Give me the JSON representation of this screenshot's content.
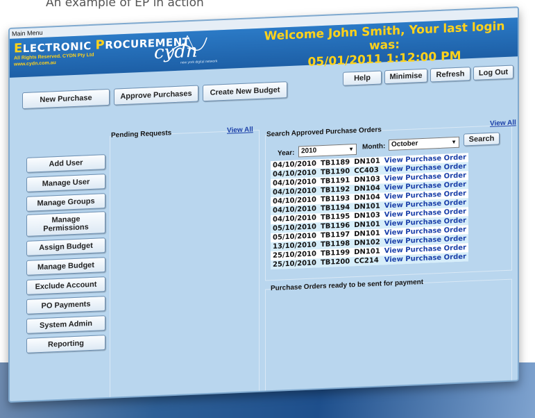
{
  "caption": "An example of EP in action",
  "window": {
    "title": "Main Menu"
  },
  "header": {
    "logo_first_letter": "E",
    "logo_word1_rest": "LECTRONIC ",
    "logo_word2_first": "P",
    "logo_word2_rest": "ROCUREMENT",
    "logo_sub_line1": "All Rights Reserved. CYDN Pty Ltd",
    "logo_sub_line2": "www.cydn.com.au",
    "brand": "cydn",
    "brand_tagline": "new york digital network",
    "welcome_line1": "Welcome John Smith, Your last login was:",
    "welcome_line2": "05/01/2011 1:12:00 PM"
  },
  "top_buttons": {
    "help": "Help",
    "minimise": "Minimise",
    "refresh": "Refresh",
    "logout": "Log Out"
  },
  "tabs": {
    "new_purchase": "New Purchase",
    "approve_purchases": "Approve Purchases",
    "create_budget": "Create New Budget"
  },
  "sidebar": [
    "Add User",
    "Manage User",
    "Manage Groups",
    "Manage\nPermissions",
    "Assign Budget",
    "Manage Budget",
    "Exclude Account",
    "PO Payments",
    "System Admin",
    "Reporting"
  ],
  "pending": {
    "title": "Pending Requests",
    "view_all": "View All"
  },
  "search": {
    "title": "Search Approved Purchase Orders",
    "view_all": "View All",
    "year_label": "Year:",
    "year_value": "2010",
    "month_label": "Month:",
    "month_value": "October",
    "button": "Search"
  },
  "orders": [
    [
      "04/10/2010",
      "TB1189",
      "DN101",
      "View Purchase Order"
    ],
    [
      "04/10/2010",
      "TB1190",
      "CC403",
      "View Purchase Order"
    ],
    [
      "04/10/2010",
      "TB1191",
      "DN103",
      "View Purchase Order"
    ],
    [
      "04/10/2010",
      "TB1192",
      "DN104",
      "View Purchase Order"
    ],
    [
      "04/10/2010",
      "TB1193",
      "DN104",
      "View Purchase Order"
    ],
    [
      "04/10/2010",
      "TB1194",
      "DN101",
      "View Purchase Order"
    ],
    [
      "04/10/2010",
      "TB1195",
      "DN103",
      "View Purchase Order"
    ],
    [
      "05/10/2010",
      "TB1196",
      "DN101",
      "View Purchase Order"
    ],
    [
      "05/10/2010",
      "TB1197",
      "DN101",
      "View Purchase Order"
    ],
    [
      "13/10/2010",
      "TB1198",
      "DN102",
      "View Purchase Order"
    ],
    [
      "25/10/2010",
      "TB1199",
      "DN101",
      "View Purchase Order"
    ],
    [
      "25/10/2010",
      "TB1200",
      "CC214",
      "View Purchase Order"
    ]
  ],
  "ready": {
    "title": "Purchase Orders ready to be sent for payment"
  },
  "colors": {
    "banner": "#1d5fa6",
    "accent_yellow": "#ffd21a",
    "background": "#b9d6ee",
    "link": "#1a3fa8"
  }
}
